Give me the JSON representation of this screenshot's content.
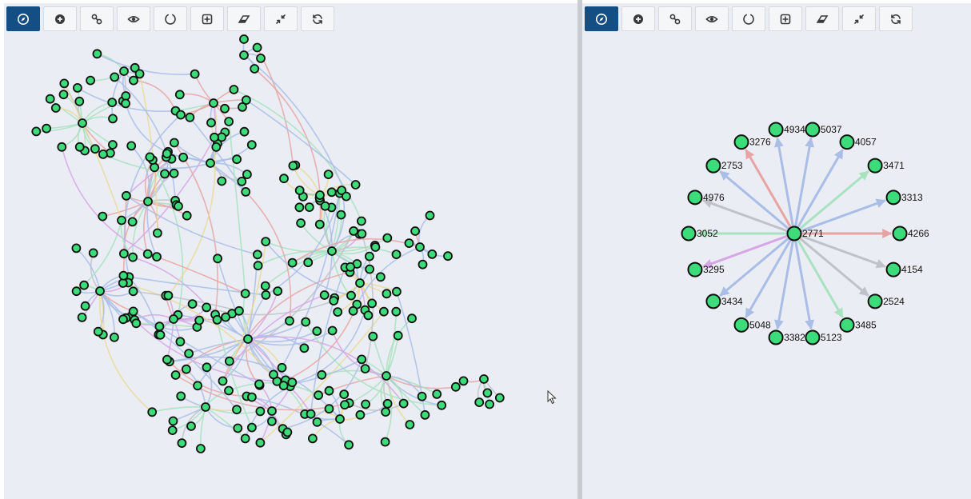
{
  "toolbar": {
    "buttons": [
      {
        "name": "navigate-button",
        "icon": "compass-icon",
        "active": true
      },
      {
        "name": "add-node-button",
        "icon": "plus-circle-icon",
        "active": false
      },
      {
        "name": "add-edge-button",
        "icon": "link-icon",
        "active": false
      },
      {
        "name": "view-button",
        "icon": "eye-icon",
        "active": false
      },
      {
        "name": "circle-layout-button",
        "icon": "circle-icon",
        "active": false
      },
      {
        "name": "expand-button",
        "icon": "plus-square-icon",
        "active": false
      },
      {
        "name": "erase-button",
        "icon": "eraser-icon",
        "active": false
      },
      {
        "name": "collapse-button",
        "icon": "compress-icon",
        "active": false
      },
      {
        "name": "refresh-button",
        "icon": "refresh-icon",
        "active": false
      }
    ]
  },
  "colors": {
    "panel_bg": "#eaedf3",
    "active_button": "#144e82",
    "node_fill": "#3ddc7a",
    "node_stroke": "#111111",
    "edge_blue": "#a9bde6",
    "edge_red": "#e8a4a4",
    "edge_green": "#a8e2c0",
    "edge_purple": "#d7a6e6",
    "edge_gray": "#bfc3c8",
    "edge_yellow": "#ead99a"
  },
  "right_graph": {
    "center": "2771",
    "neighbors": [
      {
        "id": "5037",
        "edge_color": "blue"
      },
      {
        "id": "4057",
        "edge_color": "blue"
      },
      {
        "id": "3471",
        "edge_color": "green"
      },
      {
        "id": "3313",
        "edge_color": "blue"
      },
      {
        "id": "4266",
        "edge_color": "red"
      },
      {
        "id": "4154",
        "edge_color": "gray"
      },
      {
        "id": "2524",
        "edge_color": "gray"
      },
      {
        "id": "3485",
        "edge_color": "green"
      },
      {
        "id": "5123",
        "edge_color": "blue"
      },
      {
        "id": "3382",
        "edge_color": "blue"
      },
      {
        "id": "5048",
        "edge_color": "blue"
      },
      {
        "id": "3434",
        "edge_color": "blue"
      },
      {
        "id": "3295",
        "edge_color": "purple"
      },
      {
        "id": "3052",
        "edge_color": "green"
      },
      {
        "id": "4976",
        "edge_color": "gray"
      },
      {
        "id": "2753",
        "edge_color": "blue"
      },
      {
        "id": "3276",
        "edge_color": "red"
      },
      {
        "id": "4934",
        "edge_color": "blue"
      }
    ]
  }
}
